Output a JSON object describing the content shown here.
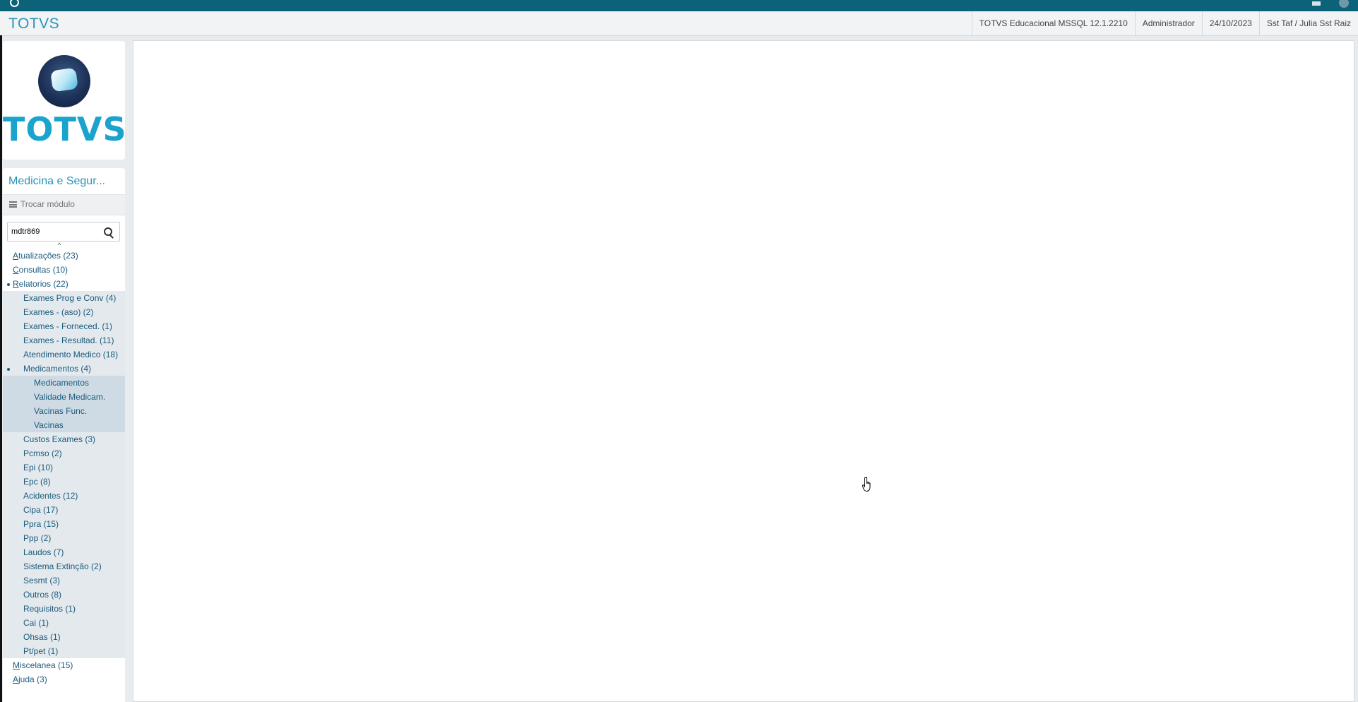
{
  "header": {
    "brand": "TOTVS",
    "environment": "TOTVS Educacional MSSQL 12.1.2210",
    "user": "Administrador",
    "date": "24/10/2023",
    "company": "Sst Taf / Julia Sst Raiz"
  },
  "logo": {
    "word": "TOTVS"
  },
  "sidebar": {
    "module_title": "Medicina e Segur...",
    "switch_module_label": "Trocar módulo",
    "search": {
      "value": "mdtr869",
      "placeholder": ""
    },
    "tree": [
      {
        "level": 1,
        "accel": "A",
        "rest": "tualizações (23)",
        "expanded": false
      },
      {
        "level": 1,
        "accel": "C",
        "rest": "onsultas (10)",
        "expanded": false
      },
      {
        "level": 1,
        "accel": "R",
        "rest": "elatorios (22)",
        "expanded": true
      },
      {
        "level": 2,
        "accel": "",
        "rest": "Exames Prog e Conv (4)",
        "expanded": false
      },
      {
        "level": 2,
        "accel": "",
        "rest": "Exames - (aso) (2)",
        "expanded": false
      },
      {
        "level": 2,
        "accel": "",
        "rest": "Exames - Forneced. (1)",
        "expanded": false
      },
      {
        "level": 2,
        "accel": "",
        "rest": "Exames - Resultad. (11)",
        "expanded": false
      },
      {
        "level": 2,
        "accel": "",
        "rest": "Atendimento Medico (18)",
        "expanded": false
      },
      {
        "level": 2,
        "accel": "",
        "rest": "Medicamentos (4)",
        "expanded": true
      },
      {
        "level": 3,
        "accel": "",
        "rest": "Medicamentos",
        "expanded": false
      },
      {
        "level": 3,
        "accel": "",
        "rest": "Validade Medicam.",
        "expanded": false
      },
      {
        "level": 3,
        "accel": "",
        "rest": "Vacinas Func.",
        "expanded": false
      },
      {
        "level": 3,
        "accel": "",
        "rest": "Vacinas",
        "expanded": false
      },
      {
        "level": 2,
        "accel": "",
        "rest": "Custos Exames (3)",
        "expanded": false
      },
      {
        "level": 2,
        "accel": "",
        "rest": "Pcmso (2)",
        "expanded": false
      },
      {
        "level": 2,
        "accel": "",
        "rest": "Epi (10)",
        "expanded": false
      },
      {
        "level": 2,
        "accel": "",
        "rest": "Epc (8)",
        "expanded": false
      },
      {
        "level": 2,
        "accel": "",
        "rest": "Acidentes (12)",
        "expanded": false
      },
      {
        "level": 2,
        "accel": "",
        "rest": "Cipa (17)",
        "expanded": false
      },
      {
        "level": 2,
        "accel": "",
        "rest": "Ppra (15)",
        "expanded": false
      },
      {
        "level": 2,
        "accel": "",
        "rest": "Ppp (2)",
        "expanded": false
      },
      {
        "level": 2,
        "accel": "",
        "rest": "Laudos (7)",
        "expanded": false
      },
      {
        "level": 2,
        "accel": "",
        "rest": "Sistema Extinção (2)",
        "expanded": false
      },
      {
        "level": 2,
        "accel": "",
        "rest": "Sesmt (3)",
        "expanded": false
      },
      {
        "level": 2,
        "accel": "",
        "rest": "Outros (8)",
        "expanded": false
      },
      {
        "level": 2,
        "accel": "",
        "rest": "Requisitos (1)",
        "expanded": false
      },
      {
        "level": 2,
        "accel": "",
        "rest": "Cai (1)",
        "expanded": false
      },
      {
        "level": 2,
        "accel": "",
        "rest": "Ohsas (1)",
        "expanded": false
      },
      {
        "level": 2,
        "accel": "",
        "rest": "Pt/pet (1)",
        "expanded": false
      },
      {
        "level": 1,
        "accel": "M",
        "rest": "iscelanea (15)",
        "expanded": false
      },
      {
        "level": 1,
        "accel": "A",
        "rest": "juda (3)",
        "expanded": false
      }
    ]
  },
  "colors": {
    "topbar": "#0c6379",
    "accent": "#2a95b8",
    "tree_text": "#1b5b7d",
    "tree_level2_bg": "#e3e9ed",
    "tree_level3_bg": "#cfdbe4"
  },
  "icons": {
    "app": "app-icon",
    "window": "window-icon",
    "info": "info-icon",
    "menu": "hamburger-icon",
    "search": "search-icon",
    "expanded": "bullet-icon",
    "pointer": "hand-cursor-icon"
  }
}
